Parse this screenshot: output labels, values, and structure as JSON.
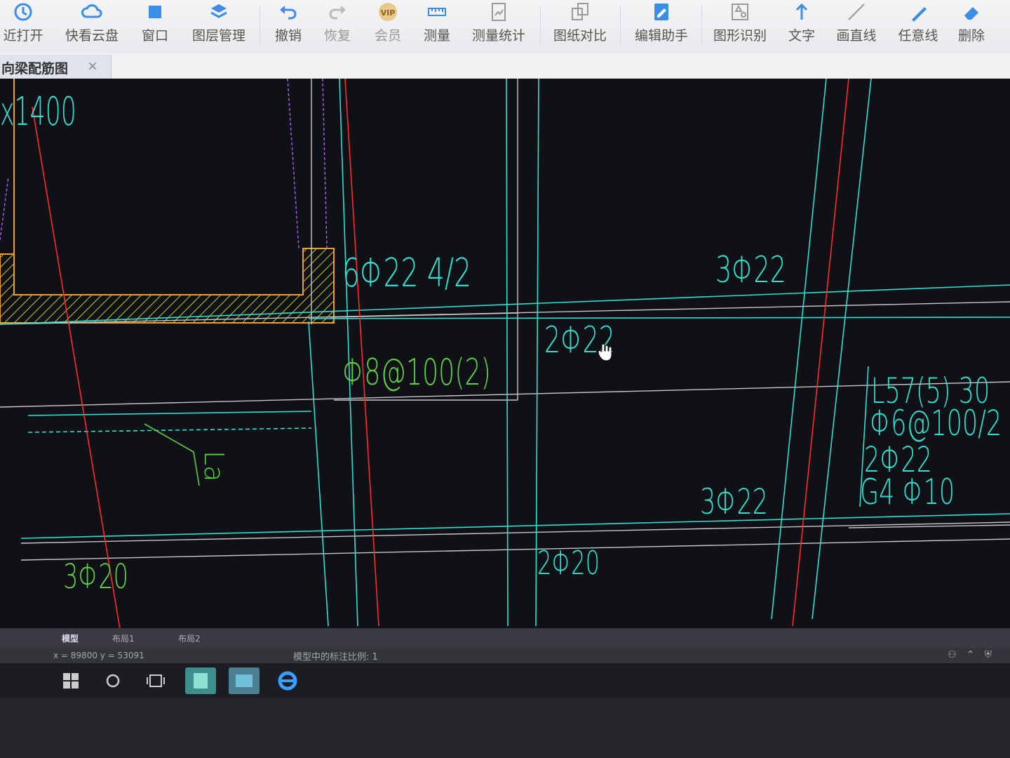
{
  "toolbar": {
    "items": [
      {
        "label": "近打开",
        "icon": "clock-icon"
      },
      {
        "label": "快看云盘",
        "icon": "cloud-icon"
      },
      {
        "label": "窗口",
        "icon": "window-icon"
      },
      {
        "label": "图层管理",
        "icon": "layers-icon"
      },
      {
        "label": "撤销",
        "icon": "undo-icon"
      },
      {
        "label": "恢复",
        "icon": "redo-icon"
      },
      {
        "label": "会员",
        "icon": "vip-icon"
      },
      {
        "label": "测量",
        "icon": "ruler-icon"
      },
      {
        "label": "测量统计",
        "icon": "measure-stats-icon"
      },
      {
        "label": "图纸对比",
        "icon": "compare-icon"
      },
      {
        "label": "编辑助手",
        "icon": "edit-assistant-icon"
      },
      {
        "label": "图形识别",
        "icon": "shape-recognition-icon"
      },
      {
        "label": "文字",
        "icon": "text-icon"
      },
      {
        "label": "画直线",
        "icon": "line-icon"
      },
      {
        "label": "任意线",
        "icon": "freehand-icon"
      },
      {
        "label": "删除",
        "icon": "eraser-icon"
      }
    ],
    "vip_badge": "VIP"
  },
  "document_tab": {
    "label": "向梁配筋图",
    "close": "×"
  },
  "drawing": {
    "texts": {
      "dim_top": "x1400",
      "rebar_top_left": "6Φ22 4/2",
      "rebar_top_right": "3Φ22",
      "rebar_mid": "2Φ22",
      "stirrup": "Φ8@100(2)",
      "la": "La",
      "rebar_bottom_right": "3Φ22",
      "rebar_bottom_left": "3Φ20",
      "rebar_bottom_mid": "2Φ20",
      "beam_l57_1": "L57(5) 30",
      "beam_l57_2": "Φ6@100/2",
      "beam_l57_3": "2Φ22",
      "beam_l57_4": "G4 Φ10"
    }
  },
  "layout_tabs": [
    "模型",
    "布局1",
    "布局2"
  ],
  "status": {
    "coords": "x = 89800  y = 53091",
    "scale": "模型中的标注比例: 1"
  },
  "colors": {
    "canvas_bg": "#101116",
    "cyan": "#2fe0d0",
    "red": "#ff2a2a",
    "green": "#5fd045",
    "yellow": "#e8e020",
    "orange": "#f0a020",
    "white_line": "#c8c8c8",
    "magenta": "#b060ff"
  }
}
